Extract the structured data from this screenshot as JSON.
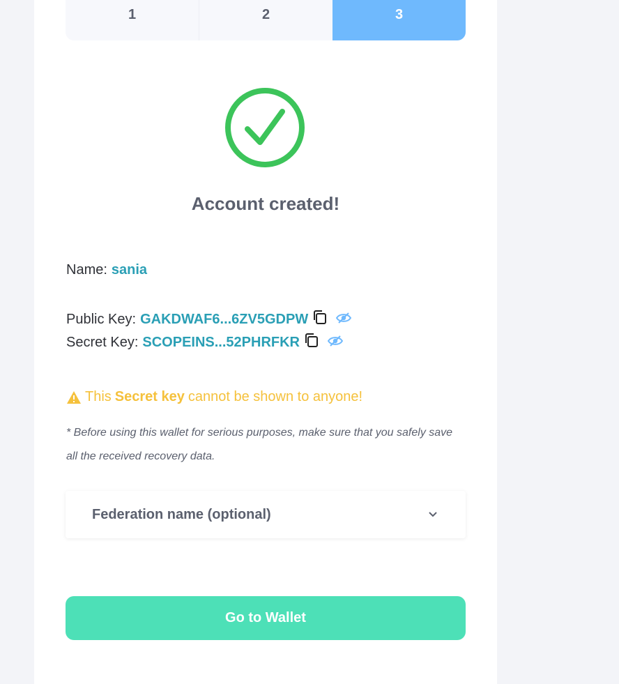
{
  "stepper": {
    "steps": [
      "1",
      "2",
      "3"
    ],
    "active_step": "3"
  },
  "result": {
    "title": "Account created!"
  },
  "account": {
    "name_label": "Name:",
    "name_value": "sania",
    "public_key_label": "Public Key:",
    "public_key_value": "GAKDWAF6...6ZV5GDPW",
    "secret_key_label": "Secret Key:",
    "secret_key_value": "SCOPEINS...52PHRFKR"
  },
  "warning": {
    "prefix": "This",
    "emphasis": "Secret key",
    "suffix": "cannot be shown to anyone!"
  },
  "note": "* Before using this wallet for serious purposes, make sure that you safely save all the received recovery data.",
  "federation": {
    "label": "Federation name (optional)"
  },
  "actions": {
    "go_to_wallet": "Go to Wallet"
  },
  "icons": {
    "success": "check-circle-icon",
    "copy": "copy-icon",
    "visibility": "eye-icon",
    "warning": "warning-triangle-icon",
    "expand": "chevron-down-icon"
  },
  "colors": {
    "accent": "#2a9fb5",
    "success": "#3cc45a",
    "warning": "#f5c13c",
    "active_step": "#6fb9fd",
    "primary_button": "#4de0b7",
    "eye": "#6fb9fd"
  }
}
